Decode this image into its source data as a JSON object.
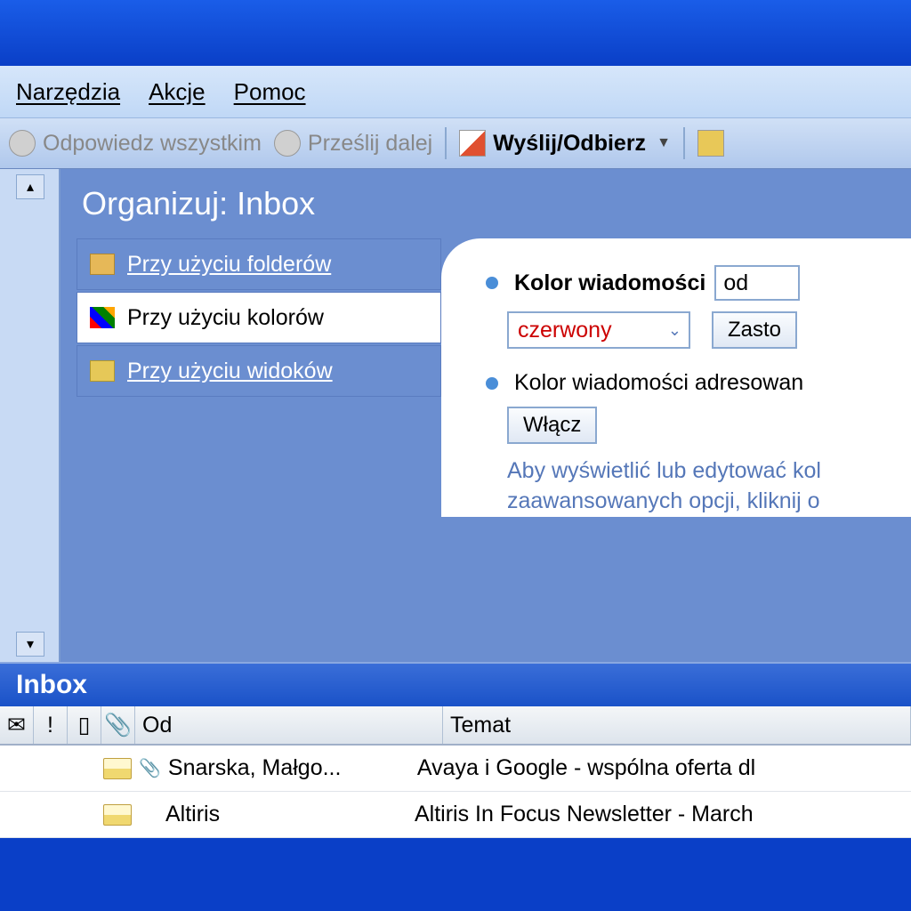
{
  "menu": {
    "tools": "Narzędzia",
    "actions": "Akcje",
    "help": "Pomoc"
  },
  "toolbar": {
    "reply_all": "Odpowiedz wszystkim",
    "forward": "Prześlij dalej",
    "send_receive": "Wyślij/Odbierz"
  },
  "organize": {
    "title": "Organizuj: Inbox",
    "tabs": {
      "folders": "Przy użyciu folderów",
      "colors": "Przy użyciu kolorów",
      "views": "Przy użyciu widoków"
    },
    "panel": {
      "color_msg_label": "Kolor wiadomości",
      "from_value": "od",
      "color_value": "czerwony",
      "apply_btn": "Zasto",
      "addressed_label": "Kolor wiadomości adresowan",
      "enable_btn": "Włącz",
      "info_line1": "Aby wyświetlić lub edytować kol",
      "info_line2": "zaawansowanych opcji, kliknij o"
    }
  },
  "inbox": {
    "header": "Inbox",
    "columns": {
      "from": "Od",
      "subject": "Temat"
    },
    "rows": [
      {
        "from": "Snarska, Małgo...",
        "subject": "Avaya i Google - wspólna oferta dl",
        "has_attachment": true
      },
      {
        "from": "Altiris",
        "subject": "Altiris In Focus Newsletter - March",
        "has_attachment": false
      }
    ]
  }
}
